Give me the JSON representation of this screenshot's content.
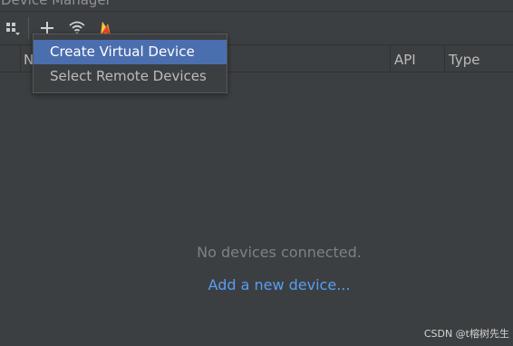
{
  "window": {
    "title": "Device Manager"
  },
  "toolbar": {
    "items": [
      {
        "icon": "device-grid-dropdown-icon"
      },
      {
        "icon": "plus-icon"
      },
      {
        "icon": "wifi-pair-icon"
      },
      {
        "icon": "firebase-flame-icon"
      }
    ]
  },
  "table": {
    "columns": [
      "N",
      "API",
      "Type"
    ]
  },
  "popup": {
    "items": [
      {
        "label": "Create Virtual Device",
        "selected": true
      },
      {
        "label": "Select Remote Devices",
        "selected": false
      }
    ]
  },
  "empty_state": {
    "message": "No devices connected.",
    "link": "Add a new device..."
  },
  "watermark": "CSDN @t榕树先生",
  "colors": {
    "background": "#3c3f41",
    "selection": "#4b6eaf",
    "link": "#589df6"
  }
}
